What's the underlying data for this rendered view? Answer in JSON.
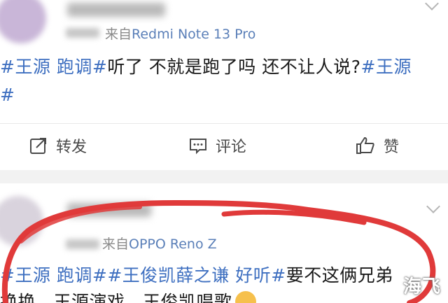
{
  "posts": [
    {
      "meta_prefix": "来自",
      "device": "Redmi Note 13 Pro",
      "content_line1": [
        {
          "text": "#王源 跑调#",
          "tag": true
        },
        {
          "text": "听了 不就是跑了吗 还不让人说?",
          "tag": false
        },
        {
          "text": "#王源",
          "tag": true
        }
      ],
      "content_line2": [
        {
          "text": "#",
          "tag": true
        }
      ],
      "actions": {
        "repost": "转发",
        "comment": "评论",
        "like": "赞"
      }
    },
    {
      "meta_prefix": "来自",
      "device": "OPPO Reno Z",
      "content_line1": [
        {
          "text": "#王源 跑调##王俊凯薛之谦 好听#",
          "tag": true
        },
        {
          "text": "要不这俩兄弟",
          "tag": false
        }
      ],
      "content_line2": [
        {
          "text": "换换，王源演戏，王俊凯唱歌",
          "tag": false
        }
      ]
    }
  ],
  "watermark": "海飞",
  "colors": {
    "tag": "#3e6fc0",
    "device": "#5a7fb8",
    "annotation": "#e03a3a"
  }
}
